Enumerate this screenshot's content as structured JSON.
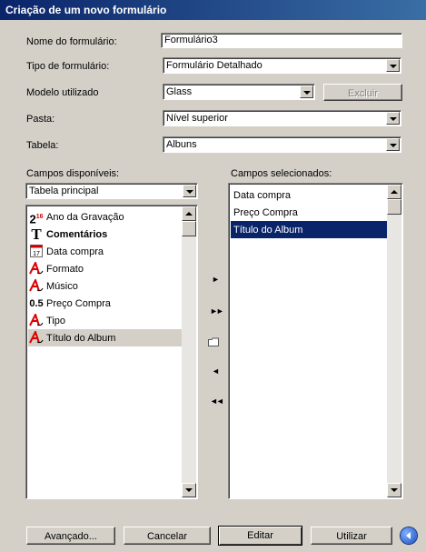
{
  "window": {
    "title": "Criação de um novo formulário"
  },
  "form": {
    "name_label": "Nome do formulário:",
    "name_value": "Formulário3",
    "type_label": "Tipo de formulário:",
    "type_value": "Formulário Detalhado",
    "model_label": "Modelo utilizado",
    "model_value": "Glass",
    "exclude_label": "Excluir",
    "folder_label": "Pasta:",
    "folder_value": "Nível superior",
    "table_label": "Tabela:",
    "table_value": "Albuns"
  },
  "available": {
    "label": "Campos disponíveis:",
    "source_value": "Tabela principal",
    "items": [
      {
        "label": "Ano da Gravação",
        "icon": "date-number-icon",
        "glyph": "2"
      },
      {
        "label": "Comentários",
        "icon": "text-memo-icon",
        "glyph": "T"
      },
      {
        "label": "Data compra",
        "icon": "calendar-icon",
        "glyph": "17"
      },
      {
        "label": "Formato",
        "icon": "text-field-icon",
        "glyph": "A"
      },
      {
        "label": "Músico",
        "icon": "text-field-icon",
        "glyph": "A"
      },
      {
        "label": "Preço Compra",
        "icon": "number-field-icon",
        "glyph": "0.5"
      },
      {
        "label": "Tipo",
        "icon": "text-field-icon",
        "glyph": "A"
      },
      {
        "label": "Título do Album",
        "icon": "text-field-icon",
        "glyph": "A"
      }
    ]
  },
  "selected": {
    "label": "Campos selecionados:",
    "items": [
      {
        "label": "Data compra"
      },
      {
        "label": "Preço Compra"
      },
      {
        "label": "Título do Album"
      }
    ]
  },
  "buttons": {
    "advanced": "Avançado...",
    "cancel": "Cancelar",
    "edit": "Editar",
    "use": "Utilizar"
  },
  "colors": {
    "selection": "#0a246a",
    "background": "#d4d0c8"
  }
}
